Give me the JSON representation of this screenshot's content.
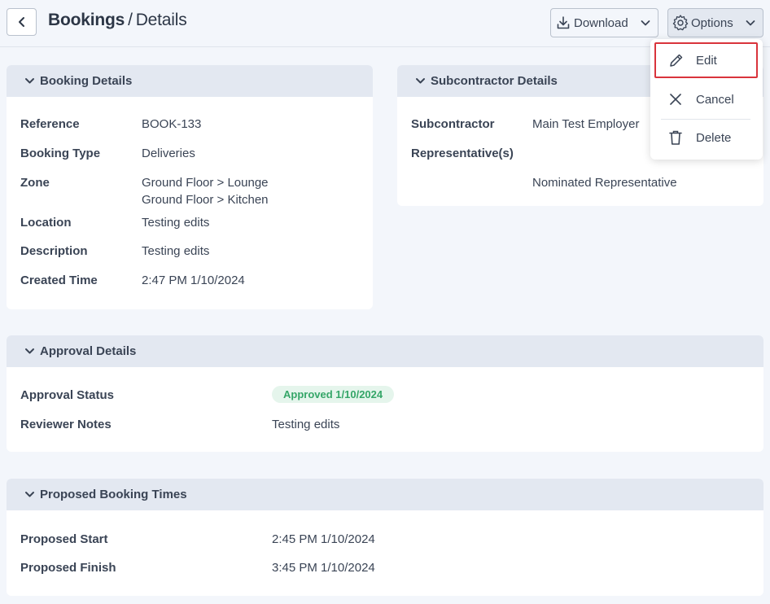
{
  "header": {
    "crumb_root": "Bookings",
    "separator": "/",
    "crumb_current": "Details",
    "download_label": "Download",
    "options_label": "Options"
  },
  "options_menu": {
    "items": [
      {
        "label": "Edit",
        "icon": "pencil-icon"
      },
      {
        "label": "Cancel",
        "icon": "close-icon"
      },
      {
        "label": "Delete",
        "icon": "trash-icon"
      }
    ]
  },
  "booking_details": {
    "title": "Booking Details",
    "rows": [
      {
        "label": "Reference",
        "value": "BOOK-133"
      },
      {
        "label": "Booking Type",
        "value": "Deliveries"
      },
      {
        "label": "Zone",
        "value": "Ground Floor > Lounge",
        "value2": "Ground Floor > Kitchen"
      },
      {
        "label": "Location",
        "value": "Testing edits"
      },
      {
        "label": "Description",
        "value": "Testing edits"
      },
      {
        "label": "Created Time",
        "value": "2:47 PM 1/10/2024"
      }
    ]
  },
  "subcontractor_details": {
    "title": "Subcontractor Details",
    "rows": [
      {
        "label": "Subcontractor",
        "value": "Main Test Employer"
      },
      {
        "label": "Representative(s)",
        "value": ""
      },
      {
        "label": "",
        "value": "Nominated Representative"
      }
    ]
  },
  "approval_details": {
    "title": "Approval Details",
    "status_label": "Approval Status",
    "status_value": "Approved 1/10/2024",
    "notes_label": "Reviewer Notes",
    "notes_value": "Testing edits"
  },
  "proposed_times": {
    "title": "Proposed Booking Times",
    "start_label": "Proposed Start",
    "start_value": "2:45 PM 1/10/2024",
    "finish_label": "Proposed Finish",
    "finish_value": "3:45 PM 1/10/2024"
  },
  "colors": {
    "accent_badge": "#35a668",
    "highlight_border": "#d9343c",
    "card_header_bg": "#e3e8f1"
  }
}
